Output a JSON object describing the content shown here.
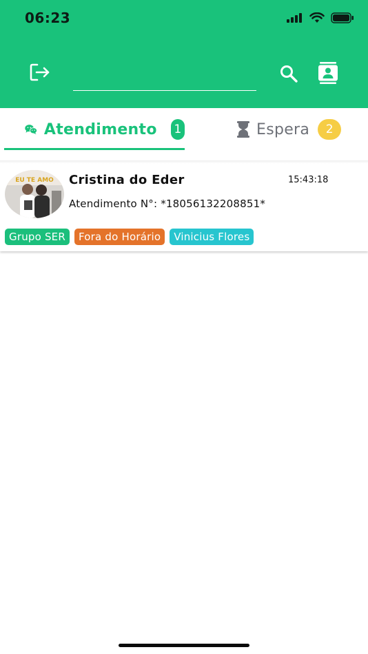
{
  "status_bar": {
    "time": "06:23",
    "icons": [
      "signal-icon",
      "wifi-icon",
      "battery-icon"
    ]
  },
  "header": {
    "logout_icon": "logout-icon",
    "search": {
      "value": "",
      "placeholder": ""
    },
    "search_icon": "search-icon",
    "contacts_icon": "contacts-icon",
    "color": "#19c27b"
  },
  "tabs": [
    {
      "label": "Atendimento",
      "count": "1",
      "icon": "chat-bubbles-icon",
      "active": true,
      "badge_color": "#19c27b"
    },
    {
      "label": "Espera",
      "count": "2",
      "icon": "hourglass-icon",
      "active": false,
      "badge_color": "#f6cd45"
    }
  ],
  "chats": [
    {
      "name": "Cristina do Eder",
      "time": "15:43:18",
      "number": "Atendimento N°: *18056132208851*",
      "avatar_text": "EU TE AMO",
      "tags": [
        {
          "label": "Grupo SER",
          "color": "#1bbf7c"
        },
        {
          "label": "Fora do Horário",
          "color": "#e4732a"
        },
        {
          "label": "Vinicius Flores",
          "color": "#27c5cf"
        }
      ]
    }
  ]
}
